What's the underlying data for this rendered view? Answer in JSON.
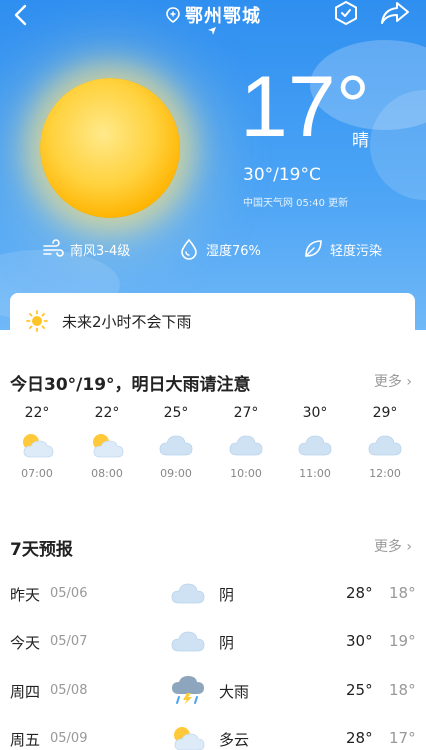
{
  "header": {
    "location": "鄂州鄂城"
  },
  "current": {
    "temperature": "17°",
    "condition": "晴",
    "range": "30°/19°C",
    "source": "中国天气网 05:40 更新"
  },
  "metrics": [
    {
      "icon": "wind-icon",
      "label": "南风3-4级"
    },
    {
      "icon": "humidity-icon",
      "label": "湿度76%"
    },
    {
      "icon": "leaf-icon",
      "label": "轻度污染"
    }
  ],
  "rain_notice": "未来2小时不会下雨",
  "today": {
    "title": "今日30°/19°，明日大雨请注意",
    "more": "更多",
    "hours": [
      {
        "temp": "22°",
        "time": "07:00",
        "icon": "partly-cloudy-icon"
      },
      {
        "temp": "22°",
        "time": "08:00",
        "icon": "partly-cloudy-icon"
      },
      {
        "temp": "25°",
        "time": "09:00",
        "icon": "cloud-icon"
      },
      {
        "temp": "27°",
        "time": "10:00",
        "icon": "cloud-icon"
      },
      {
        "temp": "30°",
        "time": "11:00",
        "icon": "cloud-icon"
      },
      {
        "temp": "29°",
        "time": "12:00",
        "icon": "cloud-icon"
      }
    ]
  },
  "forecast": {
    "title": "7天预报",
    "more": "更多",
    "days": [
      {
        "name": "昨天",
        "date": "05/06",
        "icon": "cloud-icon",
        "cond": "阴",
        "hi": "28°",
        "lo": "18°"
      },
      {
        "name": "今天",
        "date": "05/07",
        "icon": "cloud-icon",
        "cond": "阴",
        "hi": "30°",
        "lo": "19°"
      },
      {
        "name": "周四",
        "date": "05/08",
        "icon": "storm-cloud-icon",
        "cond": "大雨",
        "hi": "25°",
        "lo": "18°"
      },
      {
        "name": "周五",
        "date": "05/09",
        "icon": "partly-cloudy-icon",
        "cond": "多云",
        "hi": "28°",
        "lo": "17°"
      }
    ]
  }
}
